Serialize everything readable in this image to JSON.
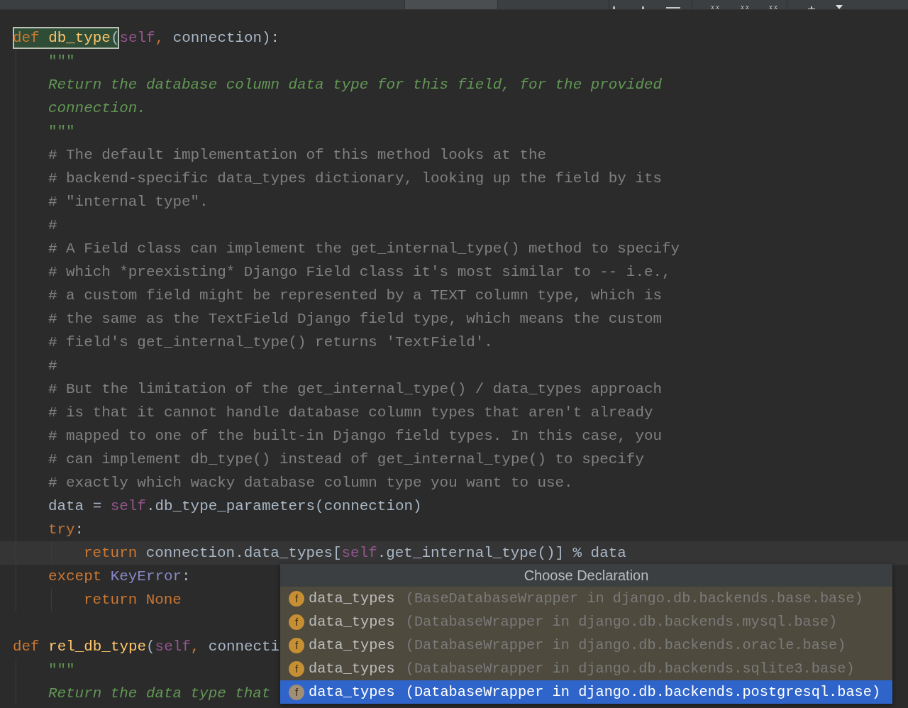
{
  "code": [
    {
      "kind": "code",
      "current": false,
      "tokens": [
        {
          "kind": "match",
          "tokens": [
            {
              "kind": "keyword",
              "text": "def "
            },
            {
              "kind": "function",
              "text": "db_type"
            },
            {
              "kind": "plain",
              "text": "("
            }
          ]
        },
        {
          "kind": "self",
          "text": "self"
        },
        {
          "kind": "punct",
          "text": ","
        },
        {
          "kind": "plain",
          "text": " connection):"
        }
      ],
      "children": [
        {
          "kind": "code",
          "current": false,
          "tokens": [
            {
              "kind": "quotes",
              "text": "\"\"\""
            }
          ]
        },
        {
          "kind": "code",
          "current": false,
          "tokens": [
            {
              "kind": "docstring",
              "text": "Return the database column data type for this field, for the provided"
            }
          ]
        },
        {
          "kind": "code",
          "current": false,
          "tokens": [
            {
              "kind": "docstring",
              "text": "connection."
            }
          ]
        },
        {
          "kind": "code",
          "current": false,
          "tokens": [
            {
              "kind": "quotes",
              "text": "\"\"\""
            }
          ]
        },
        {
          "kind": "code",
          "current": false,
          "tokens": [
            {
              "kind": "comment",
              "text": "# The default implementation of this method looks at the"
            }
          ]
        },
        {
          "kind": "code",
          "current": false,
          "tokens": [
            {
              "kind": "comment",
              "text": "# backend-specific data_types dictionary, looking up the field by its"
            }
          ]
        },
        {
          "kind": "code",
          "current": false,
          "tokens": [
            {
              "kind": "comment",
              "text": "# \"internal type\"."
            }
          ]
        },
        {
          "kind": "code",
          "current": false,
          "tokens": [
            {
              "kind": "comment",
              "text": "#"
            }
          ]
        },
        {
          "kind": "code",
          "current": false,
          "tokens": [
            {
              "kind": "comment",
              "text": "# A Field class can implement the get_internal_type() method to specify"
            }
          ]
        },
        {
          "kind": "code",
          "current": false,
          "tokens": [
            {
              "kind": "comment",
              "text": "# which *preexisting* Django Field class it's most similar to -- i.e.,"
            }
          ]
        },
        {
          "kind": "code",
          "current": false,
          "tokens": [
            {
              "kind": "comment",
              "text": "# a custom field might be represented by a TEXT column type, which is"
            }
          ]
        },
        {
          "kind": "code",
          "current": false,
          "tokens": [
            {
              "kind": "comment",
              "text": "# the same as the TextField Django field type, which means the custom"
            }
          ]
        },
        {
          "kind": "code",
          "current": false,
          "tokens": [
            {
              "kind": "comment",
              "text": "# field's get_internal_type() returns 'TextField'."
            }
          ]
        },
        {
          "kind": "code",
          "current": false,
          "tokens": [
            {
              "kind": "comment",
              "text": "#"
            }
          ]
        },
        {
          "kind": "code",
          "current": false,
          "tokens": [
            {
              "kind": "comment",
              "text": "# But the limitation of the get_internal_type() / data_types approach"
            }
          ]
        },
        {
          "kind": "code",
          "current": false,
          "tokens": [
            {
              "kind": "comment",
              "text": "# is that it cannot handle database column types that aren't already"
            }
          ]
        },
        {
          "kind": "code",
          "current": false,
          "tokens": [
            {
              "kind": "comment",
              "text": "# mapped to one of the built-in Django field types. In this case, you"
            }
          ]
        },
        {
          "kind": "code",
          "current": false,
          "tokens": [
            {
              "kind": "comment",
              "text": "# can implement db_type() instead of get_internal_type() to specify"
            }
          ]
        },
        {
          "kind": "code",
          "current": false,
          "tokens": [
            {
              "kind": "comment",
              "text": "# exactly which wacky database column type you want to use."
            }
          ]
        },
        {
          "kind": "code",
          "current": false,
          "tokens": [
            {
              "kind": "plain",
              "text": "data = "
            },
            {
              "kind": "self",
              "text": "self"
            },
            {
              "kind": "plain",
              "text": ".db_type_parameters(connection)"
            }
          ]
        },
        {
          "kind": "code",
          "current": false,
          "tokens": [
            {
              "kind": "keyword",
              "text": "try"
            },
            {
              "kind": "plain",
              "text": ":"
            }
          ],
          "children": [
            {
              "kind": "code",
              "current": true,
              "tokens": [
                {
                  "kind": "keyword",
                  "text": "return "
                },
                {
                  "kind": "plain",
                  "text": "connection.data_types["
                },
                {
                  "kind": "self",
                  "text": "self"
                },
                {
                  "kind": "plain",
                  "text": ".get_internal_type()] % data"
                }
              ]
            }
          ]
        },
        {
          "kind": "code",
          "current": false,
          "tokens": [
            {
              "kind": "keyword",
              "text": "except "
            },
            {
              "kind": "builtin",
              "text": "KeyError"
            },
            {
              "kind": "plain",
              "text": ":"
            }
          ],
          "children": [
            {
              "kind": "code",
              "current": false,
              "tokens": [
                {
                  "kind": "keyword",
                  "text": "return "
                },
                {
                  "kind": "keyword",
                  "text": "None"
                }
              ]
            }
          ]
        }
      ]
    },
    {
      "kind": "blank"
    },
    {
      "kind": "code",
      "current": false,
      "tokens": [
        {
          "kind": "keyword",
          "text": "def "
        },
        {
          "kind": "function",
          "text": "rel_db_type"
        },
        {
          "kind": "plain",
          "text": "("
        },
        {
          "kind": "self",
          "text": "self"
        },
        {
          "kind": "punct",
          "text": ","
        },
        {
          "kind": "plain",
          "text": " connecti"
        }
      ],
      "children": [
        {
          "kind": "code",
          "current": false,
          "tokens": [
            {
              "kind": "quotes",
              "text": "\"\"\""
            }
          ]
        },
        {
          "kind": "code",
          "current": false,
          "tokens": [
            {
              "kind": "docstring",
              "text": "Return the data type that"
            }
          ]
        }
      ]
    }
  ],
  "declaration_popup": {
    "title": "Choose Declaration",
    "items": [
      {
        "icon": "f",
        "name": "data_types",
        "location": "(BaseDatabaseWrapper in django.db.backends.base.base)",
        "selected": false
      },
      {
        "icon": "f",
        "name": "data_types",
        "location": "(DatabaseWrapper in django.db.backends.mysql.base)",
        "selected": false
      },
      {
        "icon": "f",
        "name": "data_types",
        "location": "(DatabaseWrapper in django.db.backends.oracle.base)",
        "selected": false
      },
      {
        "icon": "f",
        "name": "data_types",
        "location": "(DatabaseWrapper in django.db.backends.sqlite3.base)",
        "selected": false
      },
      {
        "icon": "f",
        "name": "data_types",
        "location": "(DatabaseWrapper in django.db.backends.postgresql.base)",
        "selected": true
      }
    ]
  }
}
